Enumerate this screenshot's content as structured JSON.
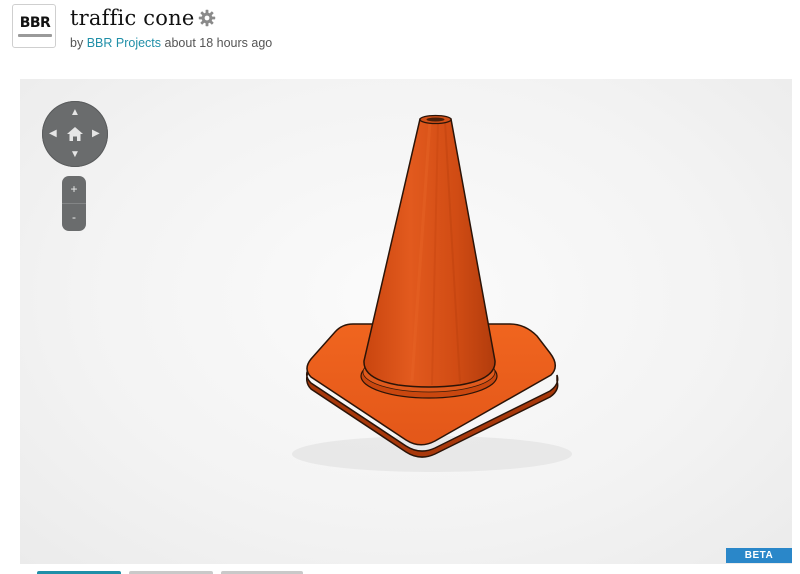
{
  "header": {
    "avatar_logo_text": "BBR",
    "title": "traffic cone",
    "byline_prefix": "by",
    "author": "BBR Projects",
    "time": "about 18 hours ago"
  },
  "viewer": {
    "nav": {
      "up": "▲",
      "down": "▼",
      "left": "◀",
      "right": "▶"
    },
    "zoom_in": "+",
    "zoom_out": "-",
    "badge": "BETA",
    "model": "traffic cone"
  },
  "colors": {
    "accent": "#1f8fa8",
    "cone": "#e8571c",
    "badge": "#2a87c9",
    "controls": "#6a6c6d"
  },
  "icons": [
    "gear-icon",
    "home-icon",
    "arrow-up-icon",
    "arrow-down-icon",
    "arrow-left-icon",
    "arrow-right-icon"
  ]
}
